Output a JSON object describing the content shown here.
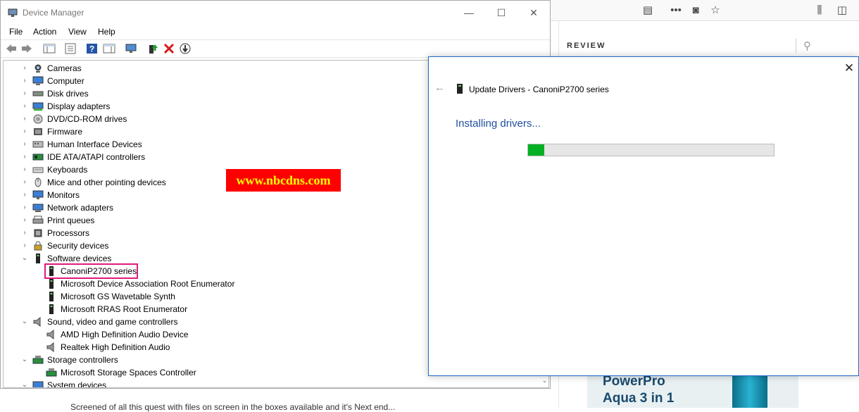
{
  "device_manager": {
    "title": "Device Manager",
    "window_controls": {
      "minimize": "—",
      "maximize": "☐",
      "close": "✕"
    },
    "menu": [
      "File",
      "Action",
      "View",
      "Help"
    ],
    "tree": [
      {
        "label": "Cameras",
        "icon": "camera-icon",
        "expanded": false
      },
      {
        "label": "Computer",
        "icon": "computer-icon",
        "expanded": false
      },
      {
        "label": "Disk drives",
        "icon": "disk-drive-icon",
        "expanded": false
      },
      {
        "label": "Display adapters",
        "icon": "display-adapter-icon",
        "expanded": false
      },
      {
        "label": "DVD/CD-ROM drives",
        "icon": "dvd-drive-icon",
        "expanded": false
      },
      {
        "label": "Firmware",
        "icon": "firmware-icon",
        "expanded": false
      },
      {
        "label": "Human Interface Devices",
        "icon": "hid-icon",
        "expanded": false
      },
      {
        "label": "IDE ATA/ATAPI controllers",
        "icon": "ide-controller-icon",
        "expanded": false
      },
      {
        "label": "Keyboards",
        "icon": "keyboard-icon",
        "expanded": false
      },
      {
        "label": "Mice and other pointing devices",
        "icon": "mouse-icon",
        "expanded": false
      },
      {
        "label": "Monitors",
        "icon": "monitor-icon",
        "expanded": false
      },
      {
        "label": "Network adapters",
        "icon": "network-adapter-icon",
        "expanded": false
      },
      {
        "label": "Print queues",
        "icon": "printer-icon",
        "expanded": false
      },
      {
        "label": "Processors",
        "icon": "processor-icon",
        "expanded": false
      },
      {
        "label": "Security devices",
        "icon": "security-device-icon",
        "expanded": false
      },
      {
        "label": "Software devices",
        "icon": "software-device-icon",
        "expanded": true,
        "children": [
          {
            "label": "CanoniP2700 series",
            "icon": "software-device-icon",
            "highlighted": true
          },
          {
            "label": "Microsoft Device Association Root Enumerator",
            "icon": "software-device-icon"
          },
          {
            "label": "Microsoft GS Wavetable Synth",
            "icon": "software-device-icon"
          },
          {
            "label": "Microsoft RRAS Root Enumerator",
            "icon": "software-device-icon"
          }
        ]
      },
      {
        "label": "Sound, video and game controllers",
        "icon": "speaker-icon",
        "expanded": true,
        "children": [
          {
            "label": "AMD High Definition Audio Device",
            "icon": "speaker-icon"
          },
          {
            "label": "Realtek High Definition Audio",
            "icon": "speaker-icon"
          }
        ]
      },
      {
        "label": "Storage controllers",
        "icon": "storage-controller-icon",
        "expanded": true,
        "children": [
          {
            "label": "Microsoft Storage Spaces Controller",
            "icon": "storage-controller-icon"
          }
        ]
      },
      {
        "label": "System devices",
        "icon": "system-device-icon",
        "expanded": true
      }
    ]
  },
  "watermark": {
    "text": "www.nbcdns.com"
  },
  "update_drivers": {
    "title": "Update Drivers - CanoniP2700 series",
    "status": "Installing drivers...",
    "progress": 0.065,
    "close": "✕",
    "back": "←"
  },
  "browser": {
    "section_label": "REVIEW",
    "ad_line1": "PowerPro",
    "ad_line2": "Aqua 3 in 1",
    "bottom_text": "Screened of all this quest with files on screen in the boxes available and it's Next end..."
  },
  "colors": {
    "accent_blue": "#1f4e9e",
    "progress_green": "#06b025",
    "highlight_pink": "#e0197d",
    "watermark_red": "#ff0000",
    "watermark_yellow": "#ffff00"
  }
}
